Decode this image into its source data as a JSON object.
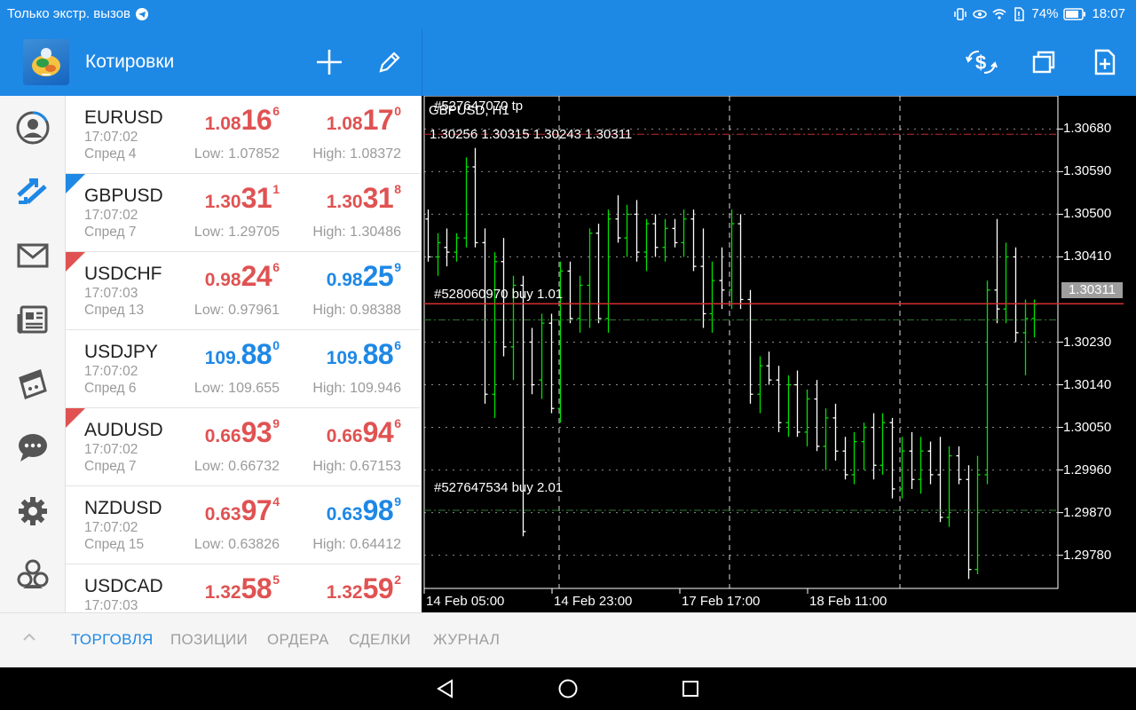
{
  "status_bar": {
    "carrier_text": "Только экстр. вызов",
    "battery": "74%",
    "time": "18:07"
  },
  "header": {
    "title": "Котировки",
    "add_icon": "plus-icon",
    "edit_icon": "pencil-icon",
    "trade_icon": "dollar-arrows-icon",
    "windows_icon": "windows-icon",
    "new_doc_icon": "new-document-icon"
  },
  "rail": {
    "items": [
      {
        "name": "account-icon"
      },
      {
        "name": "quotes-trend-icon"
      },
      {
        "name": "mail-icon"
      },
      {
        "name": "news-icon"
      },
      {
        "name": "calendar-icon"
      },
      {
        "name": "chat-icon"
      },
      {
        "name": "settings-icon"
      },
      {
        "name": "community-icon"
      }
    ]
  },
  "quotes": [
    {
      "symbol": "EURUSD",
      "time": "17:07:02",
      "spread": "Спред 4",
      "low": "Low: 1.07852",
      "high": "High: 1.08372",
      "corner": "",
      "bid": {
        "p1": "1.08",
        "p2": "16",
        "p3": "6",
        "color": "red"
      },
      "ask": {
        "p1": "1.08",
        "p2": "17",
        "p3": "0",
        "color": "red"
      }
    },
    {
      "symbol": "GBPUSD",
      "time": "17:07:02",
      "spread": "Спред 7",
      "low": "Low: 1.29705",
      "high": "High: 1.30486",
      "corner": "up",
      "bid": {
        "p1": "1.30",
        "p2": "31",
        "p3": "1",
        "color": "red"
      },
      "ask": {
        "p1": "1.30",
        "p2": "31",
        "p3": "8",
        "color": "red"
      }
    },
    {
      "symbol": "USDCHF",
      "time": "17:07:03",
      "spread": "Спред 13",
      "low": "Low: 0.97961",
      "high": "High: 0.98388",
      "corner": "down",
      "bid": {
        "p1": "0.98",
        "p2": "24",
        "p3": "6",
        "color": "red"
      },
      "ask": {
        "p1": "0.98",
        "p2": "25",
        "p3": "9",
        "color": "blue"
      }
    },
    {
      "symbol": "USDJPY",
      "time": "17:07:02",
      "spread": "Спред 6",
      "low": "Low: 109.655",
      "high": "High: 109.946",
      "corner": "",
      "bid": {
        "p1": "109.",
        "p2": "88",
        "p3": "0",
        "color": "blue"
      },
      "ask": {
        "p1": "109.",
        "p2": "88",
        "p3": "6",
        "color": "blue"
      }
    },
    {
      "symbol": "AUDUSD",
      "time": "17:07:02",
      "spread": "Спред 7",
      "low": "Low: 0.66732",
      "high": "High: 0.67153",
      "corner": "down",
      "bid": {
        "p1": "0.66",
        "p2": "93",
        "p3": "9",
        "color": "red"
      },
      "ask": {
        "p1": "0.66",
        "p2": "94",
        "p3": "6",
        "color": "red"
      }
    },
    {
      "symbol": "NZDUSD",
      "time": "17:07:02",
      "spread": "Спред 15",
      "low": "Low: 0.63826",
      "high": "High: 0.64412",
      "corner": "",
      "bid": {
        "p1": "0.63",
        "p2": "97",
        "p3": "4",
        "color": "red"
      },
      "ask": {
        "p1": "0.63",
        "p2": "98",
        "p3": "9",
        "color": "blue"
      }
    },
    {
      "symbol": "USDCAD",
      "time": "17:07:03",
      "spread": "",
      "low": "",
      "high": "",
      "corner": "",
      "bid": {
        "p1": "1.32",
        "p2": "58",
        "p3": "5",
        "color": "red"
      },
      "ask": {
        "p1": "1.32",
        "p2": "59",
        "p3": "2",
        "color": "red"
      }
    }
  ],
  "chart": {
    "title": "GBPUSD, H1",
    "overlay_order_label": "#527647070 tp",
    "ohlc": "1.30256 1.30315 1.30243 1.30311",
    "order1": "#528060970 buy 1.01",
    "order2": "#527647534 buy 2.01",
    "current_price": "1.30311",
    "y_ticks": [
      "1.30680",
      "1.30590",
      "1.30500",
      "1.30410",
      "1.30230",
      "1.30140",
      "1.30050",
      "1.29960",
      "1.29870",
      "1.29780"
    ],
    "x_ticks": [
      "14 Feb 05:00",
      "14 Feb 23:00",
      "17 Feb 17:00",
      "18 Feb 11:00"
    ],
    "colors": {
      "bull": "#00e000",
      "bear": "#ffffff",
      "tp_line": "#c62828",
      "order_line": "#2e7d32",
      "bid_line": "#d32f2f"
    }
  },
  "chart_data": {
    "type": "ohlc",
    "title": "GBPUSD, H1",
    "ylim": [
      1.2971,
      1.3075
    ],
    "y_ticks": [
      1.3068,
      1.3059,
      1.305,
      1.3041,
      1.3023,
      1.3014,
      1.3005,
      1.2996,
      1.2987,
      1.2978
    ],
    "x_labels": [
      "14 Feb 05:00",
      "14 Feb 23:00",
      "17 Feb 17:00",
      "18 Feb 11:00"
    ],
    "levels": [
      {
        "name": "#527647070 tp",
        "price": 1.30669
      },
      {
        "name": "#528060970 buy 1.01",
        "price": 1.30277
      },
      {
        "name": "#527647534 buy 2.01",
        "price": 1.29875
      },
      {
        "name": "bid",
        "price": 1.30311
      }
    ],
    "bars": [
      {
        "o": 1.3049,
        "h": 1.3051,
        "l": 1.304,
        "c": 1.3041
      },
      {
        "o": 1.3041,
        "h": 1.3046,
        "l": 1.3037,
        "c": 1.3044
      },
      {
        "o": 1.3043,
        "h": 1.3047,
        "l": 1.3039,
        "c": 1.3042
      },
      {
        "o": 1.3042,
        "h": 1.3046,
        "l": 1.304,
        "c": 1.3045
      },
      {
        "o": 1.3045,
        "h": 1.3062,
        "l": 1.3043,
        "c": 1.306
      },
      {
        "o": 1.306,
        "h": 1.3064,
        "l": 1.3043,
        "c": 1.3044
      },
      {
        "o": 1.3044,
        "h": 1.3047,
        "l": 1.301,
        "c": 1.3012
      },
      {
        "o": 1.3012,
        "h": 1.3042,
        "l": 1.3007,
        "c": 1.304
      },
      {
        "o": 1.304,
        "h": 1.3045,
        "l": 1.302,
        "c": 1.3022
      },
      {
        "o": 1.3022,
        "h": 1.3037,
        "l": 1.3015,
        "c": 1.3035
      },
      {
        "o": 1.3035,
        "h": 1.3037,
        "l": 1.2982,
        "c": 1.2983
      },
      {
        "o": 1.3023,
        "h": 1.3026,
        "l": 1.3012,
        "c": 1.3014
      },
      {
        "o": 1.3015,
        "h": 1.3029,
        "l": 1.3011,
        "c": 1.3027
      },
      {
        "o": 1.3027,
        "h": 1.3029,
        "l": 1.3008,
        "c": 1.3009
      },
      {
        "o": 1.3009,
        "h": 1.304,
        "l": 1.3006,
        "c": 1.3038
      },
      {
        "o": 1.3038,
        "h": 1.304,
        "l": 1.3027,
        "c": 1.3028
      },
      {
        "o": 1.3028,
        "h": 1.3037,
        "l": 1.3025,
        "c": 1.3035
      },
      {
        "o": 1.3035,
        "h": 1.3047,
        "l": 1.3026,
        "c": 1.3046
      },
      {
        "o": 1.3046,
        "h": 1.3048,
        "l": 1.3027,
        "c": 1.3028
      },
      {
        "o": 1.3028,
        "h": 1.3051,
        "l": 1.3025,
        "c": 1.3049
      },
      {
        "o": 1.3049,
        "h": 1.3054,
        "l": 1.3044,
        "c": 1.3045
      },
      {
        "o": 1.3045,
        "h": 1.3052,
        "l": 1.3041,
        "c": 1.305
      },
      {
        "o": 1.305,
        "h": 1.3053,
        "l": 1.304,
        "c": 1.3042
      },
      {
        "o": 1.3042,
        "h": 1.3049,
        "l": 1.3038,
        "c": 1.3048
      },
      {
        "o": 1.3048,
        "h": 1.305,
        "l": 1.3041,
        "c": 1.3043
      },
      {
        "o": 1.3043,
        "h": 1.3049,
        "l": 1.304,
        "c": 1.3047
      },
      {
        "o": 1.3047,
        "h": 1.3049,
        "l": 1.3043,
        "c": 1.3044
      },
      {
        "o": 1.3044,
        "h": 1.3051,
        "l": 1.3041,
        "c": 1.3049
      },
      {
        "o": 1.3049,
        "h": 1.3051,
        "l": 1.3038,
        "c": 1.3039
      },
      {
        "o": 1.3039,
        "h": 1.3047,
        "l": 1.3026,
        "c": 1.3029
      },
      {
        "o": 1.3029,
        "h": 1.304,
        "l": 1.3025,
        "c": 1.3036
      },
      {
        "o": 1.3036,
        "h": 1.3043,
        "l": 1.303,
        "c": 1.3034
      },
      {
        "o": 1.3034,
        "h": 1.3051,
        "l": 1.303,
        "c": 1.3048
      },
      {
        "o": 1.3048,
        "h": 1.305,
        "l": 1.303,
        "c": 1.3032
      },
      {
        "o": 1.3032,
        "h": 1.3034,
        "l": 1.301,
        "c": 1.3012
      },
      {
        "o": 1.3012,
        "h": 1.302,
        "l": 1.3008,
        "c": 1.3018
      },
      {
        "o": 1.3018,
        "h": 1.3021,
        "l": 1.3014,
        "c": 1.3015
      },
      {
        "o": 1.3015,
        "h": 1.3018,
        "l": 1.3004,
        "c": 1.3006
      },
      {
        "o": 1.3006,
        "h": 1.3016,
        "l": 1.3003,
        "c": 1.3014
      },
      {
        "o": 1.3014,
        "h": 1.3017,
        "l": 1.3003,
        "c": 1.3004
      },
      {
        "o": 1.3004,
        "h": 1.3013,
        "l": 1.3001,
        "c": 1.3011
      },
      {
        "o": 1.3011,
        "h": 1.3015,
        "l": 1.3,
        "c": 1.3001
      },
      {
        "o": 1.3001,
        "h": 1.3009,
        "l": 1.2996,
        "c": 1.3007
      },
      {
        "o": 1.3007,
        "h": 1.301,
        "l": 1.2998,
        "c": 1.3
      },
      {
        "o": 1.3,
        "h": 1.3003,
        "l": 1.2994,
        "c": 1.2995
      },
      {
        "o": 1.2995,
        "h": 1.3004,
        "l": 1.2993,
        "c": 1.3002
      },
      {
        "o": 1.3002,
        "h": 1.3006,
        "l": 1.2996,
        "c": 1.3005
      },
      {
        "o": 1.3005,
        "h": 1.3008,
        "l": 1.2994,
        "c": 1.2997
      },
      {
        "o": 1.2997,
        "h": 1.3008,
        "l": 1.2995,
        "c": 1.3006
      },
      {
        "o": 1.3006,
        "h": 1.3007,
        "l": 1.299,
        "c": 1.2992
      },
      {
        "o": 1.2992,
        "h": 1.3003,
        "l": 1.299,
        "c": 1.3
      },
      {
        "o": 1.3,
        "h": 1.3004,
        "l": 1.2992,
        "c": 1.2994
      },
      {
        "o": 1.2994,
        "h": 1.3003,
        "l": 1.2991,
        "c": 1.3
      },
      {
        "o": 1.3,
        "h": 1.3002,
        "l": 1.2993,
        "c": 1.2995
      },
      {
        "o": 1.2995,
        "h": 1.3003,
        "l": 1.2985,
        "c": 1.2986
      },
      {
        "o": 1.2986,
        "h": 1.3001,
        "l": 1.2984,
        "c": 1.2999
      },
      {
        "o": 1.2999,
        "h": 1.3001,
        "l": 1.2993,
        "c": 1.2994
      },
      {
        "o": 1.2994,
        "h": 1.2997,
        "l": 1.2973,
        "c": 1.2975
      },
      {
        "o": 1.2975,
        "h": 1.2999,
        "l": 1.2974,
        "c": 1.2995
      },
      {
        "o": 1.2995,
        "h": 1.3036,
        "l": 1.2993,
        "c": 1.3034
      },
      {
        "o": 1.3034,
        "h": 1.3049,
        "l": 1.3027,
        "c": 1.303
      },
      {
        "o": 1.303,
        "h": 1.3044,
        "l": 1.3027,
        "c": 1.3041
      },
      {
        "o": 1.3041,
        "h": 1.3043,
        "l": 1.3023,
        "c": 1.3025
      },
      {
        "o": 1.3025,
        "h": 1.3032,
        "l": 1.3016,
        "c": 1.3028
      },
      {
        "o": 1.3028,
        "h": 1.3032,
        "l": 1.3024,
        "c": 1.3031
      }
    ]
  },
  "tabs": [
    {
      "label": "ТОРГОВЛЯ",
      "active": true
    },
    {
      "label": "ПОЗИЦИИ",
      "active": false
    },
    {
      "label": "ОРДЕРА",
      "active": false
    },
    {
      "label": "СДЕЛКИ",
      "active": false
    },
    {
      "label": "ЖУРНАЛ",
      "active": false
    }
  ],
  "system_nav": {
    "back_icon": "back-triangle-icon",
    "home_icon": "home-circle-icon",
    "recents_icon": "recents-square-icon"
  }
}
